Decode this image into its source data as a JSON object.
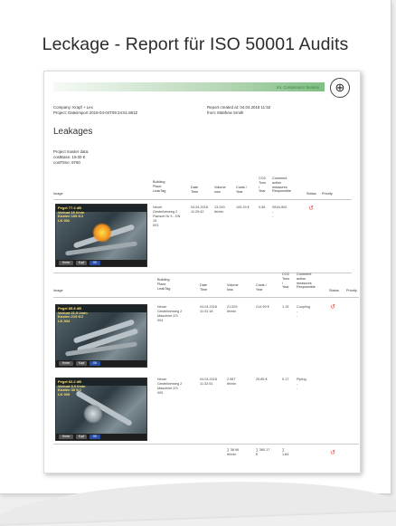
{
  "title": "Leckage - Report für ISO 50001 Audits",
  "report": {
    "header_text": "Int. Compressor Service",
    "company": "Company: Krapf + Lex",
    "project": "Project: Dateiimport 2018-04-04T09:34:51.881Z",
    "created": "Report created at: 04.04.2018 11:52",
    "from": "from: Matthew Smith",
    "heading": "Leakages",
    "master": "Project master data:",
    "cost_base": "costBase: 19.00 €",
    "cost_time": "costTime: 8760",
    "columns": {
      "image": "Image",
      "building": "Building\nPlace\nLeakTag",
      "date": "Date\nTime",
      "volume": "Volume\nloss",
      "costs": "Costs /\nYear",
      "co2": "CO2\nTons\n/\nYear",
      "comment": "Comment\naction\nmeasures\nResponsible",
      "status": "Status",
      "priority": "Priority"
    },
    "rows": [
      {
        "building": "Neuer\nGestellverweg 2\nFlansch Nr 3 - DN\n15\n003",
        "date": "04.04.2018\n11:29:42",
        "volume": "13.249\nltr/min",
        "costs": "105.33 €",
        "co2": "0.56",
        "comment": "SEALING\n-\n-",
        "readout": [
          "Pegel 77.4 dB",
          "Verlust 16 l/min",
          "Kosten 105 €/J",
          "LK 002"
        ]
      },
      {
        "building": "Neuer\nGestellverweg 2\nMaschine 2/3\n004",
        "date": "04.04.2018\n11:31:18",
        "volume": "21.529\nltr/min",
        "costs": "214.99 €",
        "co2": "1.15",
        "comment": "Coupling\n-\n-",
        "readout": [
          "Pegel 85.8 dB",
          "Verlust 21.5 l/min",
          "Kosten 215 €/J",
          "LK 004"
        ]
      },
      {
        "building": "Neuer\nGestellverweg 2\nMaschine 2/3\n005",
        "date": "04.04.2018\n11:32:51",
        "volume": "2.987\nltr/min",
        "costs": "29.85 €",
        "co2": "0.17",
        "comment": "Piping\n-\n-",
        "readout": [
          "Pegel 62.2 dB",
          "Verlust 3.0 l/min",
          "Kosten 30 €/J",
          "LK 005"
        ]
      }
    ],
    "totals": {
      "volume": "∑ 38.96\nltr/min",
      "costs": "∑ 360.17\n€",
      "co2": "∑\n1.84"
    },
    "shot_buttons": [
      "Home",
      "Kopf",
      "OK"
    ]
  },
  "colors": {
    "accent": "#3b7d3f",
    "undo": "#e0453a"
  }
}
